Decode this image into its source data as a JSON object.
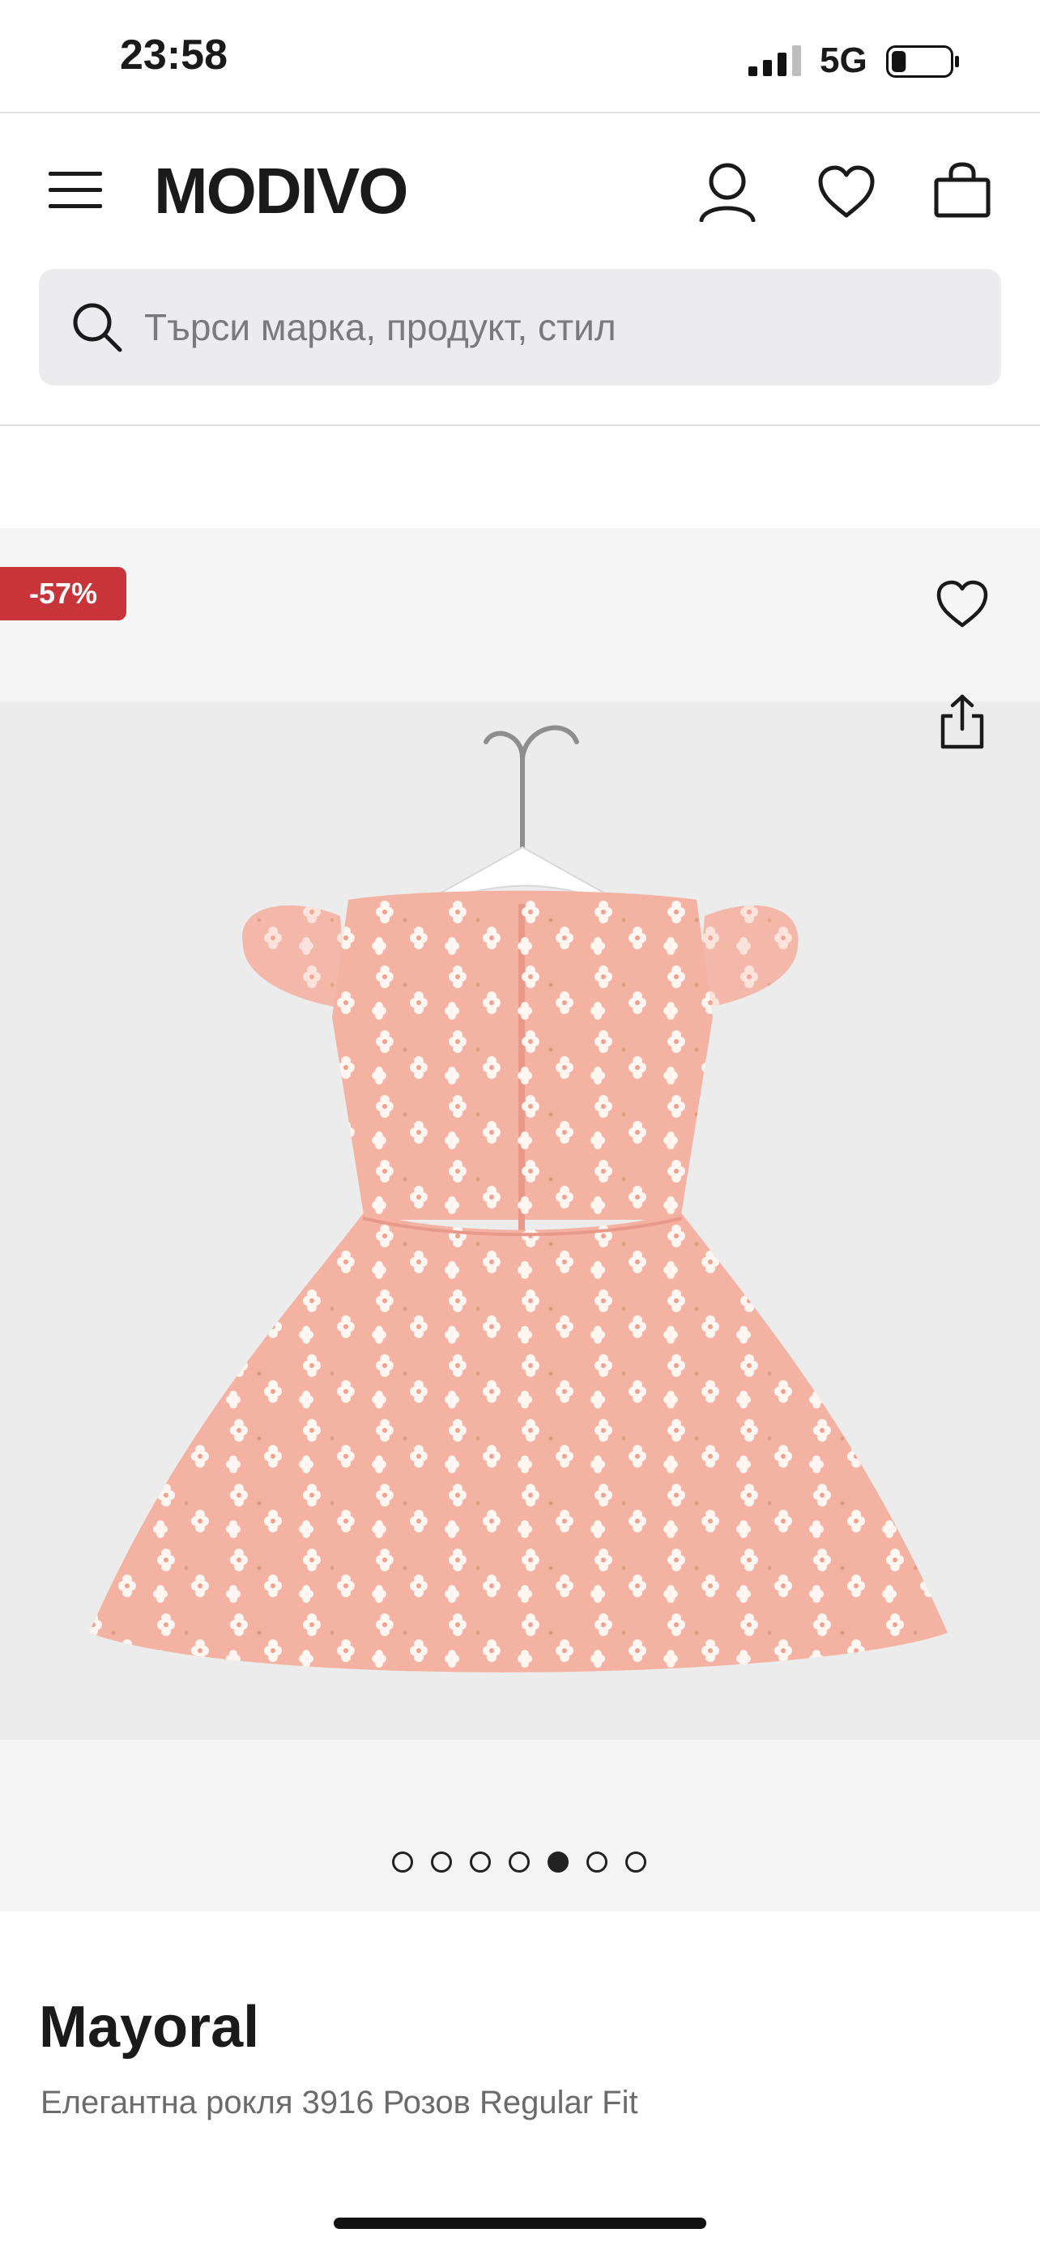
{
  "status_bar": {
    "time": "23:58",
    "network": "5G",
    "signal_icon": "signal-bars-icon",
    "battery_icon": "battery-icon",
    "battery_level": 0.25
  },
  "header": {
    "logo": "MODIVO",
    "icons": [
      "menu-icon",
      "account-icon",
      "heart-icon",
      "shopping-bag-icon"
    ]
  },
  "search": {
    "placeholder": "Търси марка, продукт, стил",
    "value": ""
  },
  "gallery": {
    "discount_badge": "-57%",
    "image_count": 7,
    "active_index": 4,
    "actions": [
      "wishlist-heart-icon",
      "share-icon"
    ],
    "image_subject": "pink tulle floral dress on hanger, back view",
    "colors": {
      "dress": "#f4b3a2",
      "flowers": "#fff6f2",
      "background": "#ececec"
    }
  },
  "product": {
    "brand": "Mayoral",
    "name": "Елегантна рокля 3916 Розов Regular Fit"
  }
}
